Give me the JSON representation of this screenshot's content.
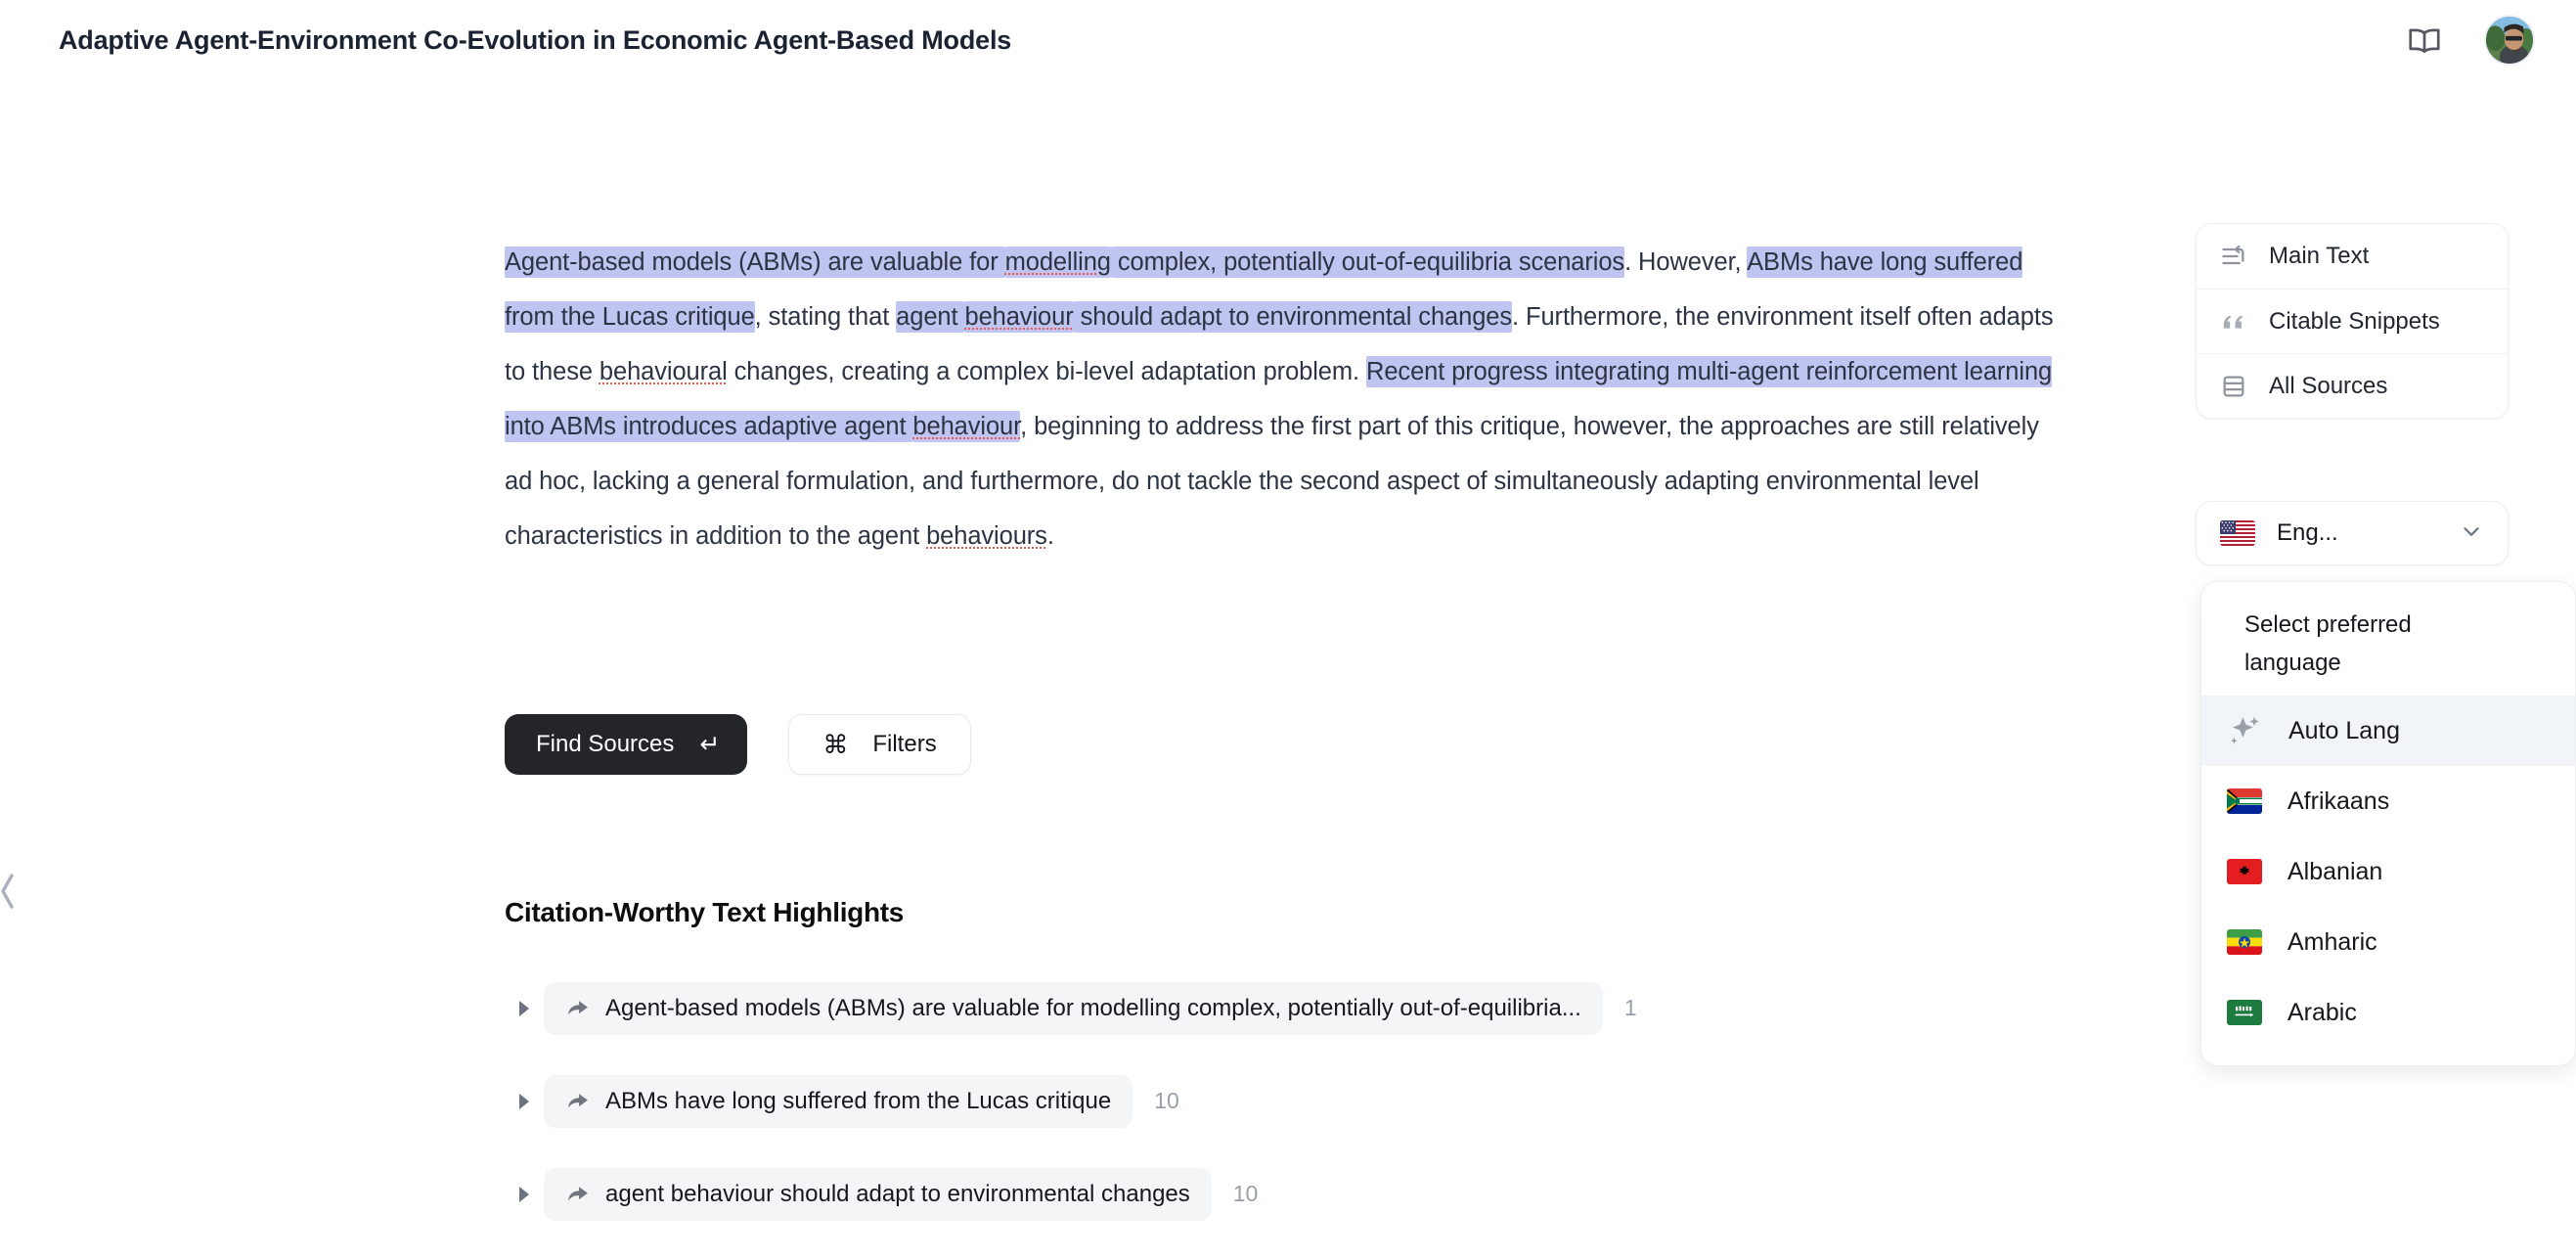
{
  "header": {
    "title": "Adaptive Agent-Environment Co-Evolution in Economic Agent-Based Models",
    "book_icon": "book-icon",
    "avatar_icon": "user-avatar"
  },
  "left_handle": {
    "icon": "chevron-left-icon"
  },
  "main_text": {
    "segments": [
      {
        "text": "Agent-based models (ABMs) are valuable for ",
        "highlight": true,
        "spell": false
      },
      {
        "text": "modelling",
        "highlight": true,
        "spell": true
      },
      {
        "text": " complex, potentially out-of-equilibria scenarios",
        "highlight": true,
        "spell": false
      },
      {
        "text": ". However, ",
        "highlight": false,
        "spell": false
      },
      {
        "text": "ABMs have long suffered from the Lucas critique",
        "highlight": true,
        "spell": false
      },
      {
        "text": ", stating that ",
        "highlight": false,
        "spell": false
      },
      {
        "text": "agent ",
        "highlight": true,
        "spell": false
      },
      {
        "text": "behaviour",
        "highlight": true,
        "spell": true
      },
      {
        "text": " should adapt to environmental changes",
        "highlight": true,
        "spell": false
      },
      {
        "text": ". Furthermore, the environment itself often adapts to these ",
        "highlight": false,
        "spell": false
      },
      {
        "text": "behavioural",
        "highlight": false,
        "spell": true
      },
      {
        "text": " changes, creating a complex bi-level adaptation problem. ",
        "highlight": false,
        "spell": false
      },
      {
        "text": "Recent progress integrating multi-agent reinforcement learning into ABMs introduces adaptive agent ",
        "highlight": true,
        "spell": false
      },
      {
        "text": "behaviour",
        "highlight": true,
        "spell": true
      },
      {
        "text": ", beginning to address the first part of this critique, however, the approaches are still relatively ad hoc, lacking a general formulation, and furthermore, do not tackle the second aspect of simultaneously adapting environmental level characteristics in addition to the agent ",
        "highlight": false,
        "spell": false
      },
      {
        "text": "behaviours",
        "highlight": false,
        "spell": true
      },
      {
        "text": ".",
        "highlight": false,
        "spell": false
      }
    ]
  },
  "actions": {
    "find_sources_label": "Find Sources",
    "find_sources_shortcut": "↵",
    "filters_label": "Filters",
    "filters_shortcut": "⌘"
  },
  "highlights_section": {
    "title": "Citation-Worthy Text Highlights",
    "rows": [
      {
        "text": "Agent-based models (ABMs) are valuable for modelling complex, potentially out-of-equilibria...",
        "count": "1"
      },
      {
        "text": "ABMs have long suffered from the Lucas critique",
        "count": "10"
      },
      {
        "text": "agent behaviour should adapt to environmental changes",
        "count": "10"
      }
    ]
  },
  "right_panel": {
    "nav": [
      {
        "label": "Main Text",
        "icon": "text-indent-icon"
      },
      {
        "label": "Citable Snippets",
        "icon": "quote-icon"
      },
      {
        "label": "All Sources",
        "icon": "rows-icon"
      }
    ],
    "language": {
      "selected_label": "Eng...",
      "selected_flag": "flag-us",
      "chevron": "chevron-down-icon",
      "menu_title": "Select preferred language",
      "options": [
        {
          "label": "Auto Lang",
          "icon": "sparkle-icon",
          "selected": true
        },
        {
          "label": "Afrikaans",
          "icon": "flag-za",
          "selected": false
        },
        {
          "label": "Albanian",
          "icon": "flag-al",
          "selected": false
        },
        {
          "label": "Amharic",
          "icon": "flag-et",
          "selected": false
        },
        {
          "label": "Arabic",
          "icon": "flag-sa",
          "selected": false
        }
      ]
    }
  },
  "colors": {
    "highlight": "#bfc4f0",
    "primary_button": "#242529",
    "spellcheck_underline": "#e8604d",
    "pill_background": "#f4f5f7",
    "menu_selected": "#f1f4f9"
  }
}
